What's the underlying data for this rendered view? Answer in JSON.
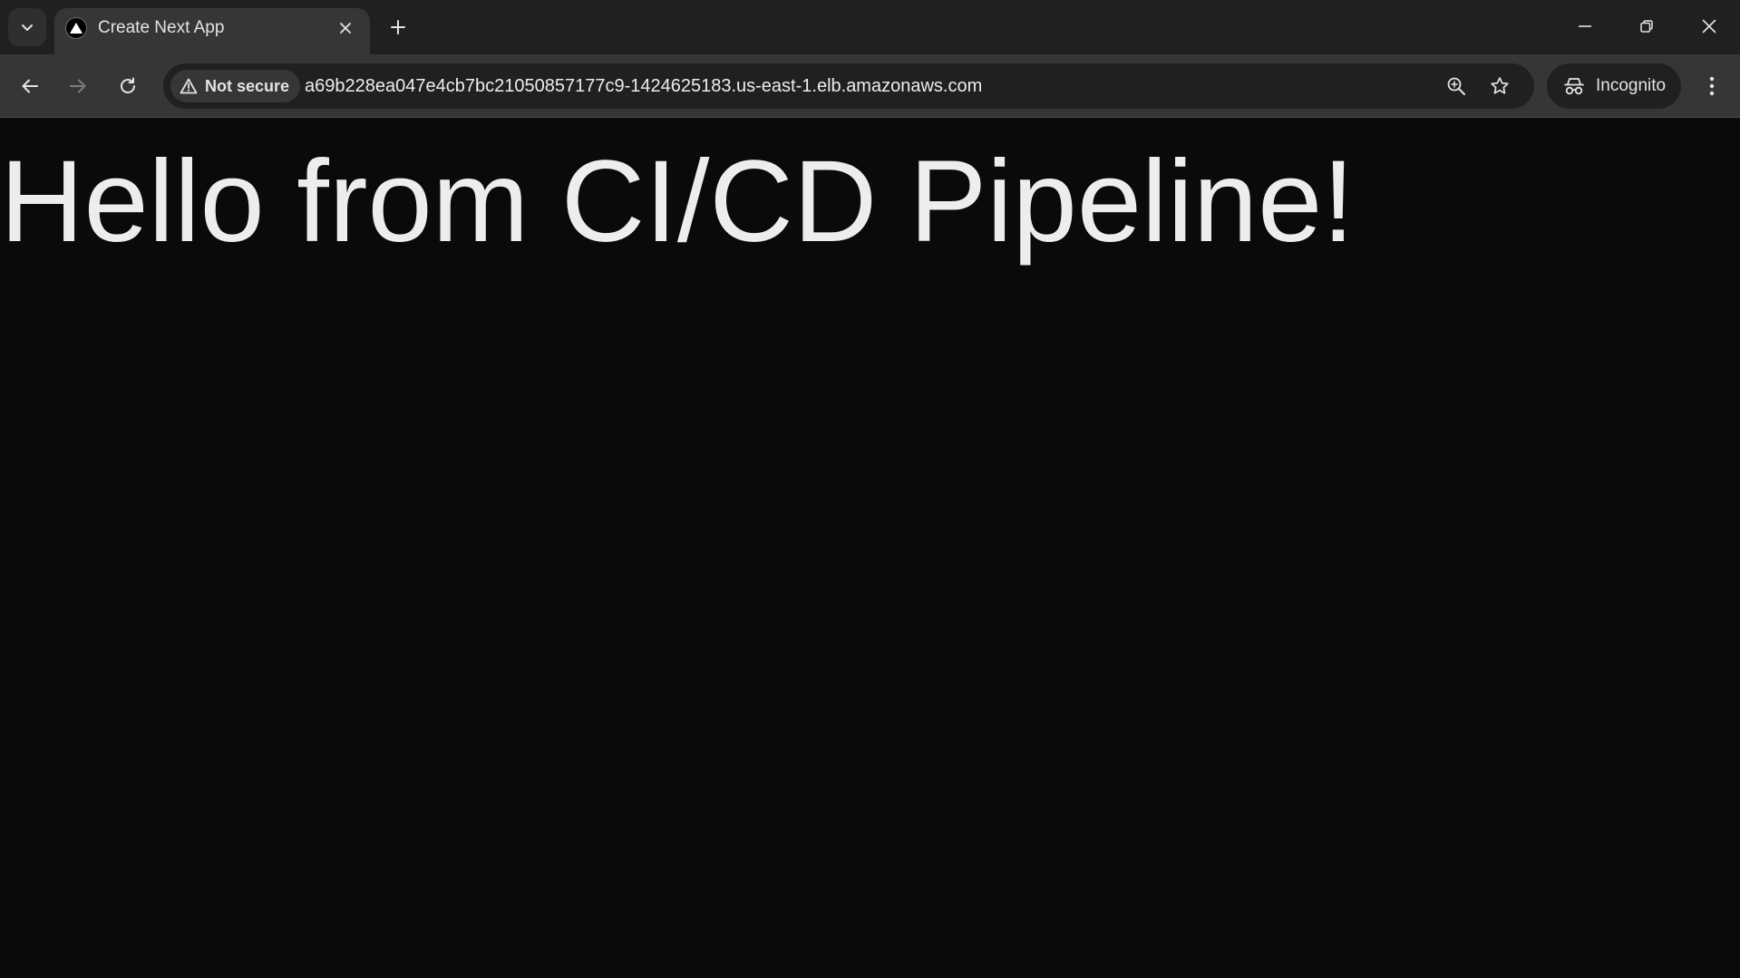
{
  "tab": {
    "title": "Create Next App"
  },
  "omnibox": {
    "security_label": "Not secure",
    "url": "a69b228ea047e4cb7bc21050857177c9-1424625183.us-east-1.elb.amazonaws.com"
  },
  "profile": {
    "label": "Incognito"
  },
  "page": {
    "heading": "Hello from CI/CD Pipeline!"
  },
  "icons": {
    "tab_search": "chevron-down-icon",
    "favicon": "nextjs-triangle-icon",
    "tab_close": "close-icon",
    "new_tab": "plus-icon",
    "minimize": "minimize-icon",
    "restore": "restore-icon",
    "window_close": "close-icon",
    "back": "arrow-left-icon",
    "forward": "arrow-right-icon",
    "reload": "reload-icon",
    "warning": "warning-triangle-icon",
    "zoom": "zoom-in-icon",
    "bookmark": "star-icon",
    "incognito": "incognito-icon",
    "menu": "kebab-menu-icon"
  },
  "colors": {
    "page_background": "#0a0a0a",
    "heading_text": "#ededed",
    "tabstrip_background": "#1f2021",
    "toolbar_background": "#353638"
  }
}
